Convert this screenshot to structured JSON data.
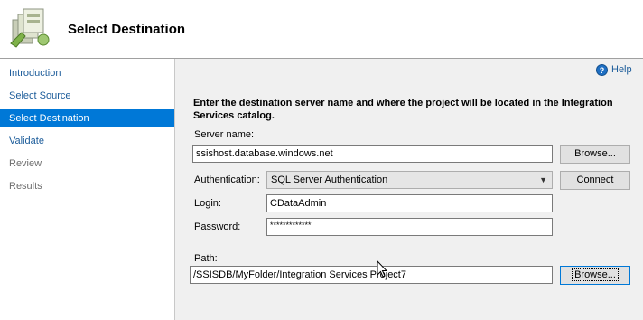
{
  "header": {
    "title": "Select Destination",
    "icon": "wizard-page-icon"
  },
  "sidebar": {
    "items": [
      {
        "label": "Introduction",
        "state": "link"
      },
      {
        "label": "Select Source",
        "state": "link"
      },
      {
        "label": "Select Destination",
        "state": "selected"
      },
      {
        "label": "Validate",
        "state": "link"
      },
      {
        "label": "Review",
        "state": "disabled"
      },
      {
        "label": "Results",
        "state": "disabled"
      }
    ]
  },
  "help": {
    "label": "Help",
    "icon": "help-icon"
  },
  "main": {
    "instructions": "Enter the destination server name and where the project will be located in the Integration Services catalog.",
    "server_name": {
      "label": "Server name:",
      "value": "ssishost.database.windows.net",
      "browse_label": "Browse..."
    },
    "authentication": {
      "label": "Authentication:",
      "value": "SQL Server Authentication",
      "connect_label": "Connect"
    },
    "login": {
      "label": "Login:",
      "value": "CDataAdmin"
    },
    "password": {
      "label": "Password:",
      "value": "*************"
    },
    "path": {
      "label": "Path:",
      "value": "/SSISDB/MyFolder/Integration Services Project7",
      "browse_label": "Browse..."
    }
  },
  "colors": {
    "selection": "#0078d7",
    "link": "#1c5c9a",
    "window": "#f0f0f0"
  }
}
